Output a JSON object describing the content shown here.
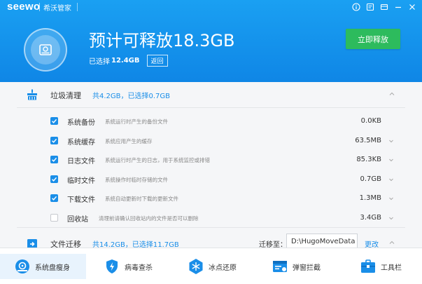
{
  "titlebar": {
    "logo": "seewo",
    "app_name": "希沃管家",
    "icons": [
      "info-icon",
      "feedback-icon",
      "skin-icon",
      "minimize-icon",
      "close-icon"
    ]
  },
  "header": {
    "headline": "预计可释放18.3GB",
    "selected_prefix": "已选择",
    "selected_value": "12.4GB",
    "back_label": "返回",
    "release_label": "立即释放"
  },
  "junk": {
    "title": "垃圾清理",
    "stat": "共4.2GB，已选择0.7GB",
    "items": [
      {
        "label": "系统备份",
        "desc": "系统运行时产生的备份文件",
        "size": "0.0KB",
        "checked": true,
        "expandable": false
      },
      {
        "label": "系统缓存",
        "desc": "系统应用产生的缓存",
        "size": "63.5MB",
        "checked": true,
        "expandable": true
      },
      {
        "label": "日志文件",
        "desc": "系统运行时产生的日志，用于系统监控或排错",
        "size": "85.3KB",
        "checked": true,
        "expandable": true
      },
      {
        "label": "临时文件",
        "desc": "系统操作时临时存储的文件",
        "size": "0.7GB",
        "checked": true,
        "expandable": true
      },
      {
        "label": "下载文件",
        "desc": "系统自动更新时下载的更新文件",
        "size": "1.3MB",
        "checked": true,
        "expandable": true
      },
      {
        "label": "回收站",
        "desc": "清理前请确认回收站内的文件是否可以删除",
        "size": "3.4GB",
        "checked": false,
        "expandable": true
      }
    ]
  },
  "migrate": {
    "title": "文件迁移",
    "stat": "共14.2GB，已选择11.7GB",
    "to_label": "迁移至：",
    "path": "D:\\HugoMoveData",
    "change_label": "更改"
  },
  "toolbar": [
    {
      "label": "系统盘瘦身",
      "icon": "disk-slim-icon",
      "active": true
    },
    {
      "label": "病毒查杀",
      "icon": "shield-icon",
      "active": false
    },
    {
      "label": "冰点还原",
      "icon": "snowflake-icon",
      "active": false
    },
    {
      "label": "弹窗拦截",
      "icon": "popup-block-icon",
      "active": false
    },
    {
      "label": "工具栏",
      "icon": "toolbox-icon",
      "active": false
    }
  ],
  "colors": {
    "header_blue": "#1592ea",
    "accent_blue": "#1a8ee8",
    "release_green": "#2dbb5d"
  }
}
